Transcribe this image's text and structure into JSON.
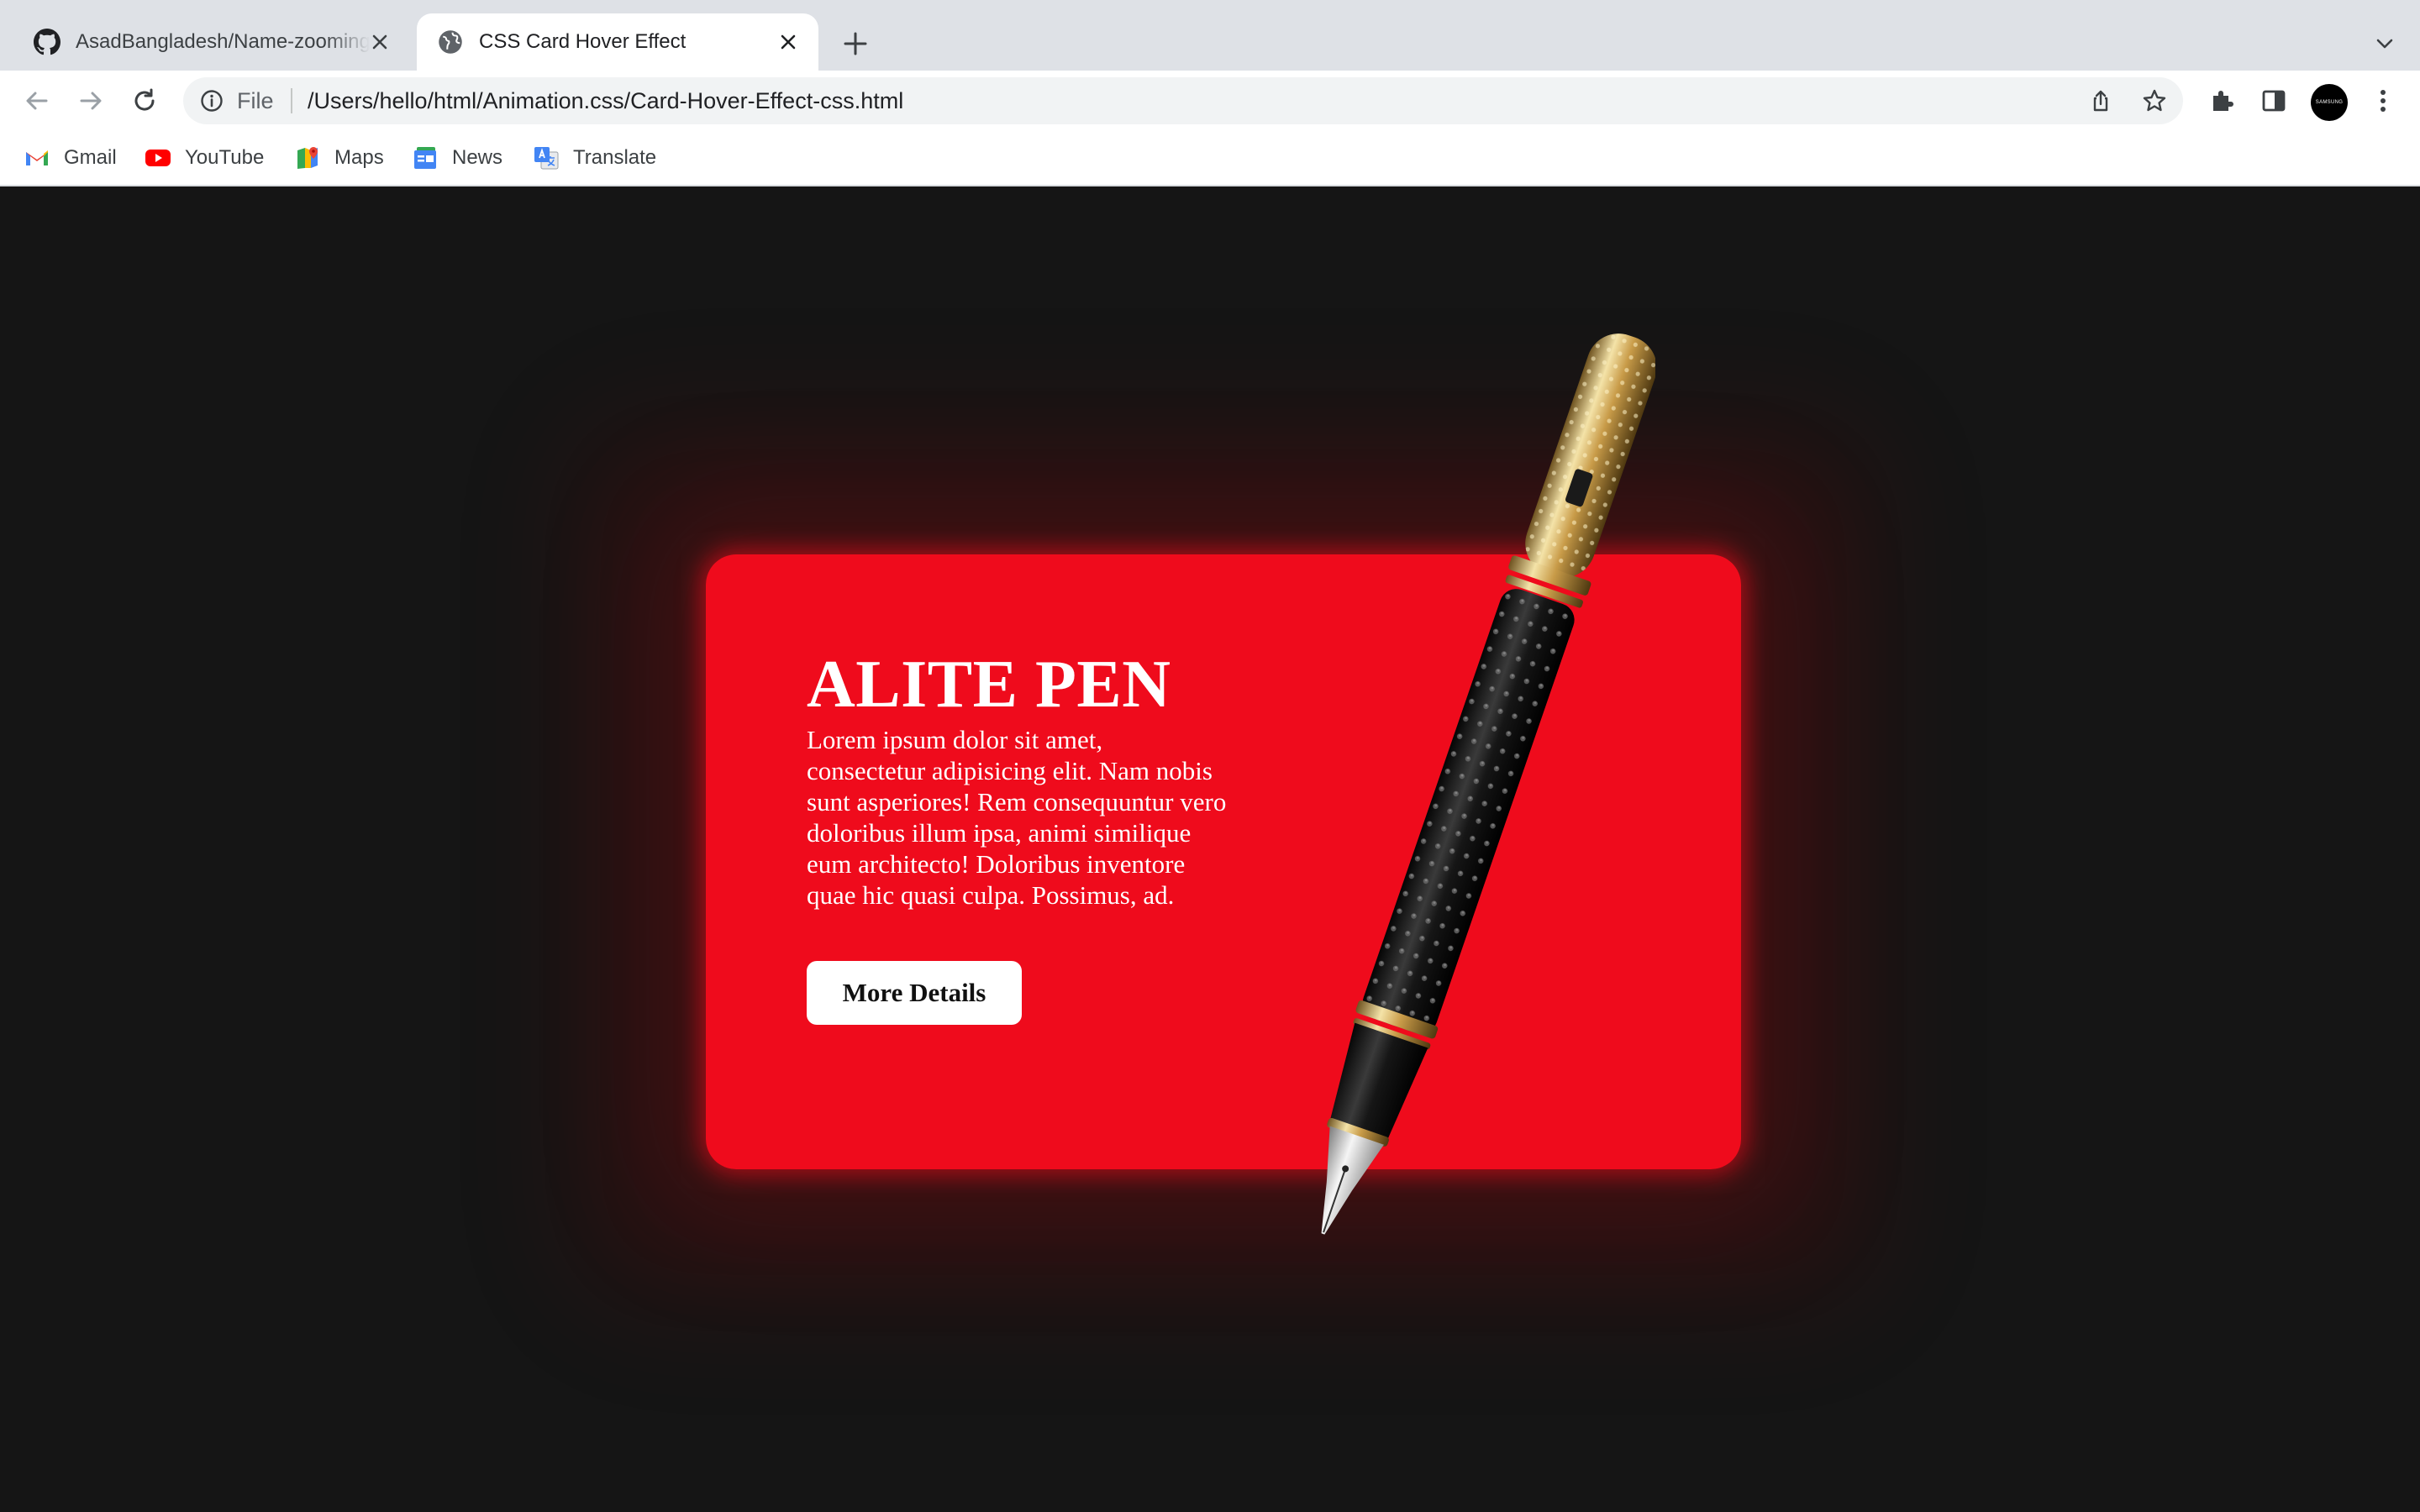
{
  "browser": {
    "tabs": [
      {
        "title": "AsadBangladesh/Name-zooming-animation",
        "favicon": "github-icon",
        "active": false
      },
      {
        "title": "CSS Card Hover Effect",
        "favicon": "globe-icon",
        "active": true
      }
    ],
    "omnibox": {
      "scheme_label": "File",
      "url": "/Users/hello/html/Animation.css/Card-Hover-Effect-css.html"
    },
    "profile_label": "SAMSUNG",
    "bookmarks": [
      {
        "label": "Gmail",
        "icon": "gmail-icon"
      },
      {
        "label": "YouTube",
        "icon": "youtube-icon"
      },
      {
        "label": "Maps",
        "icon": "maps-icon"
      },
      {
        "label": "News",
        "icon": "news-icon"
      },
      {
        "label": "Translate",
        "icon": "translate-icon"
      }
    ]
  },
  "page": {
    "background_color": "#151515",
    "card": {
      "color": "#ef0b1c",
      "title": "ALITE PEN",
      "description": "Lorem ipsum dolor sit amet, consectetur adipisicing elit. Nam nobis sunt asperiores! Rem consequuntur vero doloribus illum ipsa, animi similique eum architecto! Doloribus inventore quae hic quasi culpa. Possimus, ad.",
      "button_label": "More Details",
      "image": "fountain-pen"
    }
  }
}
